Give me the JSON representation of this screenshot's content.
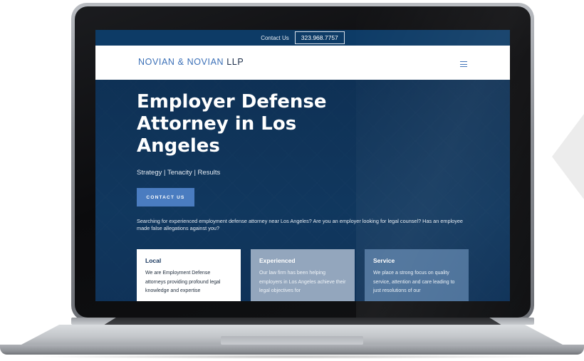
{
  "topbar": {
    "contact_label": "Contact Us",
    "phone": "323.968.7757"
  },
  "navbar": {
    "logo_part1": "NOVIAN & NOVIAN",
    "logo_part2": "LLP",
    "menu_icon": "hamburger-menu-icon"
  },
  "hero": {
    "title": "Employer Defense Attorney in Los Angeles",
    "subtitle": "Strategy | Tenacity | Results",
    "cta_label": "CONTACT US",
    "intro": "Searching for experienced employment defense attorney near Los Angeles? Are you an employer looking for legal counsel? Has an employee made false allegations against you?"
  },
  "cards": [
    {
      "title": "Local",
      "text": "We are Employment Defense attorneys providing profound legal knowledge and expertise"
    },
    {
      "title": "Experienced",
      "text": "Our law firm has been helping employers in Los Angeles achieve their legal objectives for"
    },
    {
      "title": "Service",
      "text": "We place a strong focus on quality service, attention and care leading to just resolutions of our"
    }
  ],
  "colors": {
    "topbar": "#0d3b66",
    "accent": "#4a7cc0",
    "hero": "#143b63"
  }
}
